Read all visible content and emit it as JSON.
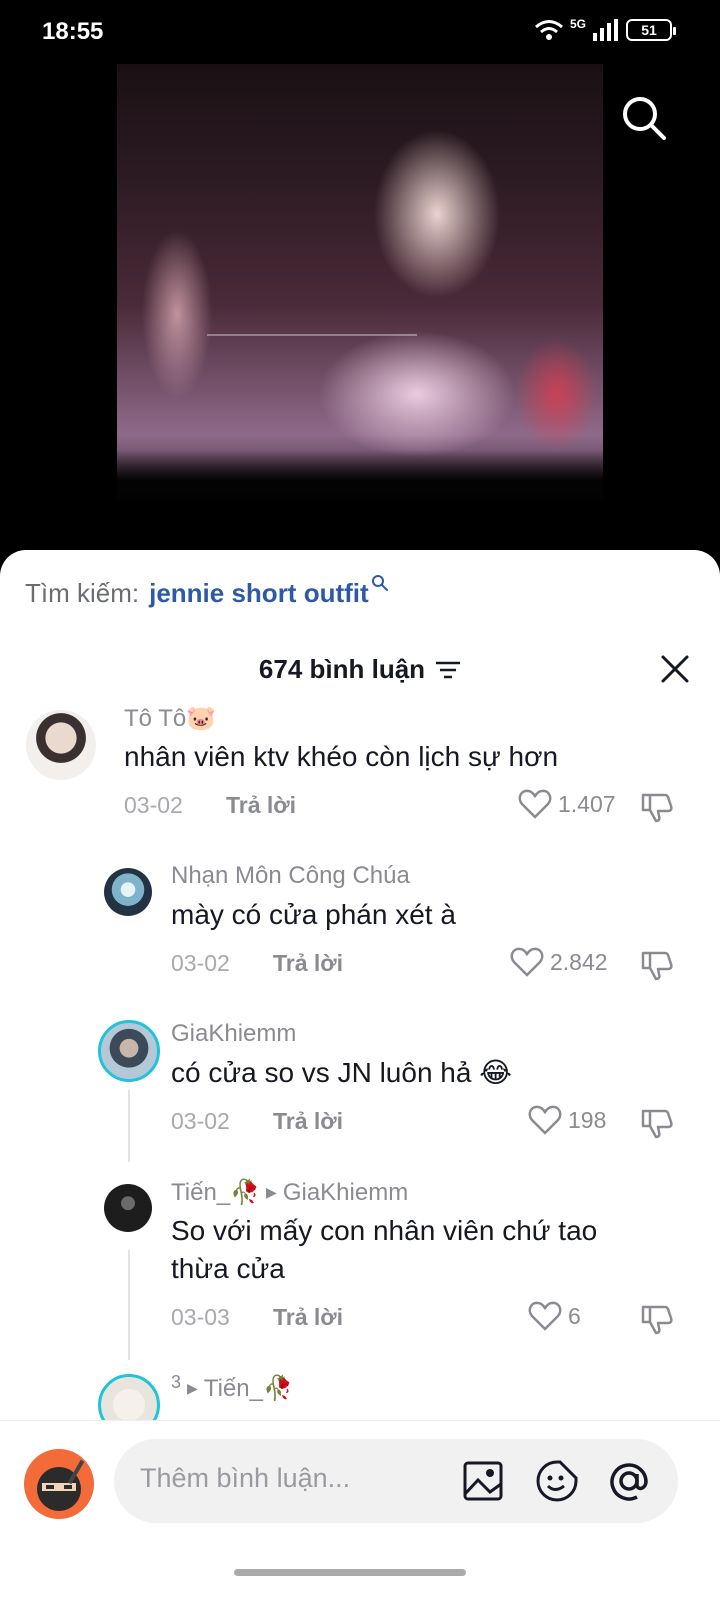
{
  "status_bar": {
    "time": "18:55",
    "network": "5G",
    "battery": "51"
  },
  "search_suggestion": {
    "label": "Tìm kiếm:",
    "term": "jennie short outfit"
  },
  "comments_header": {
    "count_label": "674 bình luận"
  },
  "comments": [
    {
      "name": "Tô Tô🐷",
      "text": "nhân viên ktv khéo còn lịch sự hơn",
      "date": "03-02",
      "reply": "Trả lời",
      "likes": "1.407"
    },
    {
      "name": "Nhạn Môn Công Chúa",
      "text": "mày có cửa phán xét à",
      "date": "03-02",
      "reply": "Trả lời",
      "likes": "2.842"
    },
    {
      "name": "GiaKhiemm",
      "text": "có cửa so vs JN luôn hả 😂",
      "date": "03-02",
      "reply": "Trả lời",
      "likes": "198"
    },
    {
      "name": "Tiến_🥀",
      "reply_to": "GiaKhiemm",
      "text": "So với mấy con nhân viên chứ tao thừa cửa",
      "date": "03-03",
      "reply": "Trả lời",
      "likes": "6"
    },
    {
      "name": "3",
      "reply_to": "Tiến_🥀"
    }
  ],
  "composer": {
    "placeholder": "Thêm bình luận..."
  },
  "icons": [
    "search-icon",
    "filter-icon",
    "close-icon",
    "heart-icon",
    "dislike-icon",
    "image-icon",
    "sticker-icon",
    "mention-icon"
  ]
}
